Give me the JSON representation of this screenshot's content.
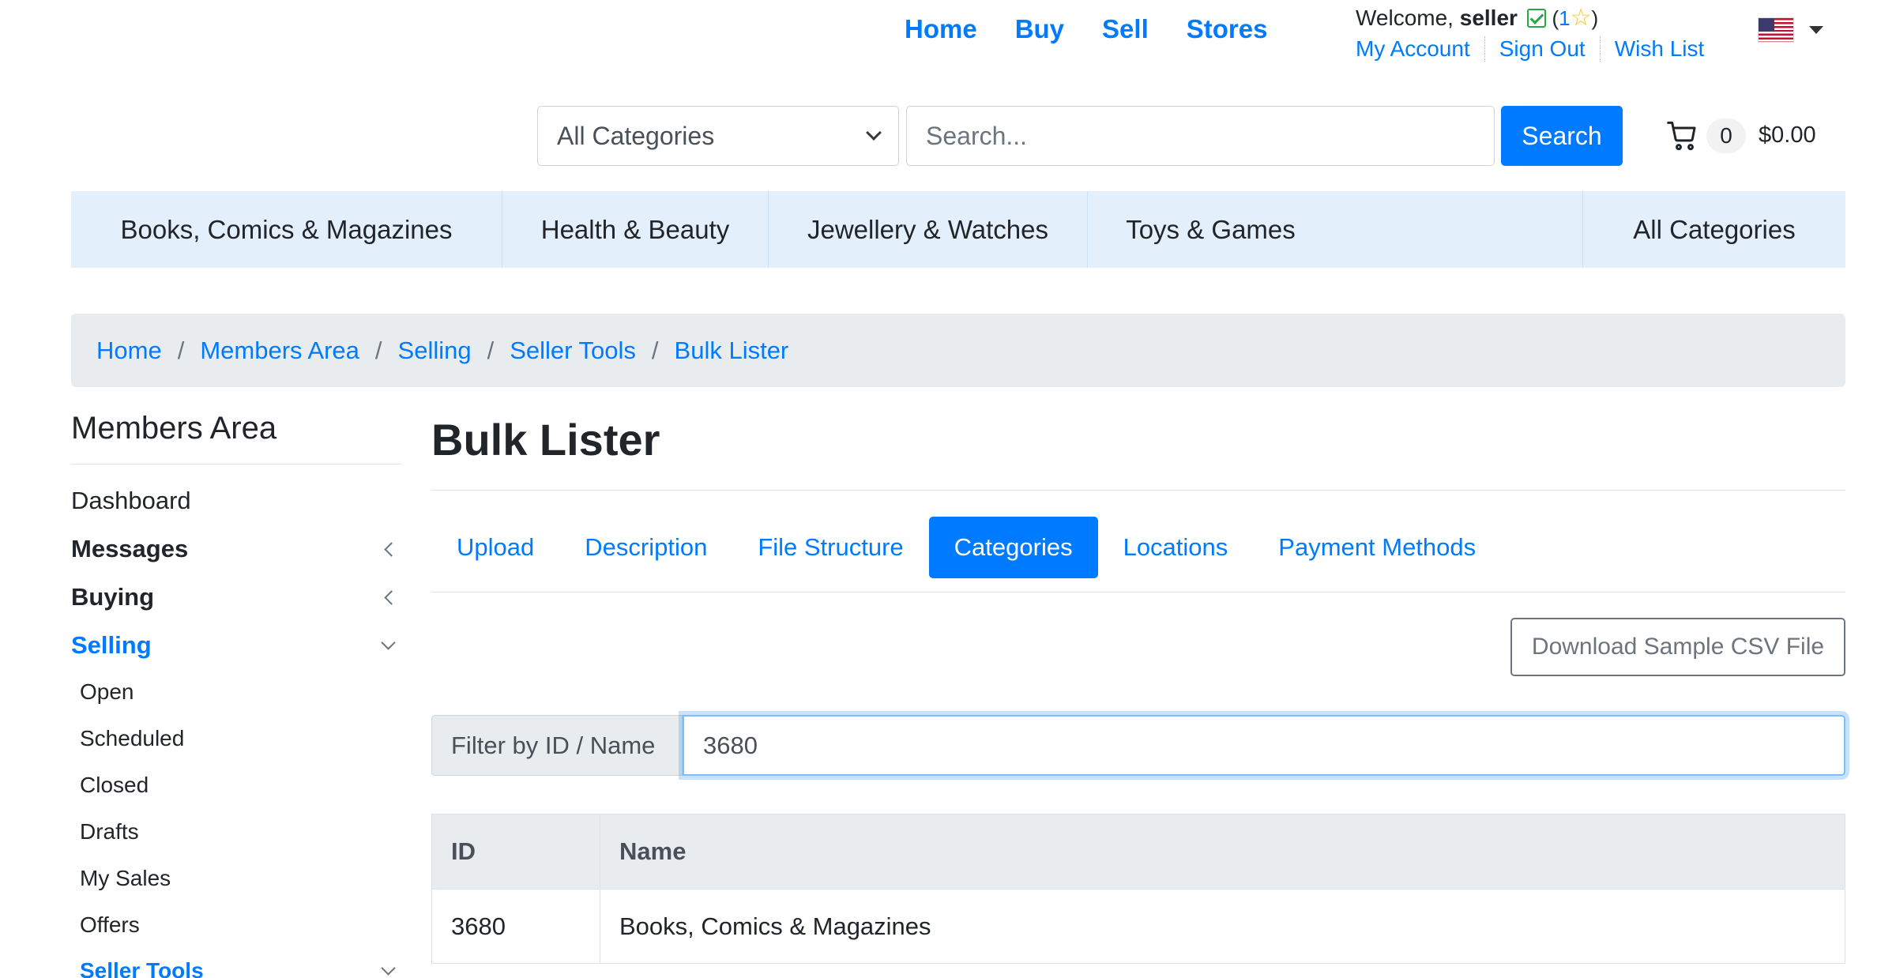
{
  "topnav": {
    "home": "Home",
    "buy": "Buy",
    "sell": "Sell",
    "stores": "Stores"
  },
  "user": {
    "welcome_prefix": "Welcome,",
    "username": "seller",
    "feedback_open": "(",
    "feedback_score": "1",
    "feedback_close": ")",
    "links": {
      "my_account": "My Account",
      "sign_out": "Sign Out",
      "wish_list": "Wish List"
    }
  },
  "icons": {
    "verified": "check-square-icon",
    "star": "star-icon",
    "flag": "us-flag-icon",
    "cart": "cart-icon"
  },
  "search": {
    "category_value": "All Categories",
    "placeholder": "Search...",
    "button": "Search"
  },
  "cart": {
    "count": "0",
    "total": "$0.00"
  },
  "categories": [
    "Books, Comics & Magazines",
    "Health & Beauty",
    "Jewellery & Watches",
    "Toys & Games",
    "All Categories"
  ],
  "breadcrumb": [
    "Home",
    "Members Area",
    "Selling",
    "Seller Tools",
    "Bulk Lister"
  ],
  "sidebar": {
    "title": "Members Area",
    "dashboard": "Dashboard",
    "messages": "Messages",
    "buying": "Buying",
    "selling": "Selling",
    "selling_items": [
      "Open",
      "Scheduled",
      "Closed",
      "Drafts",
      "My Sales",
      "Offers",
      "Seller Tools"
    ]
  },
  "main": {
    "title": "Bulk Lister",
    "tabs": [
      "Upload",
      "Description",
      "File Structure",
      "Categories",
      "Locations",
      "Payment Methods"
    ],
    "active_tab": "Categories",
    "download_button": "Download Sample CSV File",
    "filter_label": "Filter by ID / Name",
    "filter_value": "3680",
    "table": {
      "headers": [
        "ID",
        "Name"
      ],
      "rows": [
        [
          "3680",
          "Books, Comics & Magazines"
        ]
      ]
    }
  },
  "colors": {
    "primary": "#007bff",
    "category_bar": "#e3f0fb",
    "breadcrumb_bg": "#e9ecef",
    "verified": "#28a745",
    "star": "#f5c518"
  }
}
